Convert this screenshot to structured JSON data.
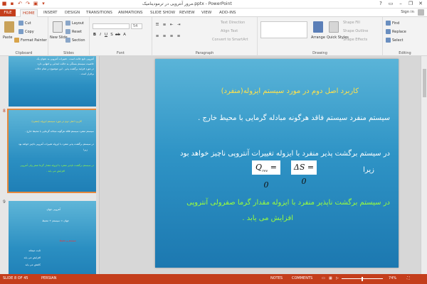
{
  "window": {
    "title": "مرور آنتروپی در ترمودینامیک.pptx - PowerPoint"
  },
  "qat": [
    "save-icon",
    "undo-icon",
    "redo-icon",
    "start-slideshow-icon",
    "customize-icon"
  ],
  "window_controls": [
    "?",
    "minimize",
    "restore",
    "close"
  ],
  "tabs": [
    "FILE",
    "HOME",
    "INSERT",
    "DESIGN",
    "TRANSITIONS",
    "ANIMATIONS",
    "SLIDE SHOW",
    "REVIEW",
    "VIEW",
    "ADD-INS"
  ],
  "active_tab": "HOME",
  "account": {
    "signin": "Sign in"
  },
  "ribbon": {
    "clipboard": {
      "paste": "Paste",
      "cut": "Cut",
      "copy": "Copy",
      "format_painter": "Format Painter",
      "label": "Clipboard"
    },
    "slides": {
      "new_slide": "New Slide",
      "layout": "Layout",
      "reset": "Reset",
      "section": "Section",
      "label": "Slides"
    },
    "font": {
      "name": "",
      "size": "54",
      "label": "Font"
    },
    "paragraph": {
      "text_direction": "Text Direction",
      "align_text": "Align Text",
      "convert": "Convert to SmartArt",
      "label": "Paragraph"
    },
    "drawing": {
      "arrange": "Arrange",
      "quick_styles": "Quick Styles",
      "shape_fill": "Shape Fill",
      "shape_outline": "Shape Outline",
      "shape_effects": "Shape Effects",
      "label": "Drawing"
    },
    "editing": {
      "find": "Find",
      "replace": "Replace",
      "select": "Select",
      "label": "Editing"
    }
  },
  "thumbnails": [
    {
      "number": "",
      "lines": [
        {
          "text": "آنتروپی تابع حالت است . تغییرات آنتروپی به عنوان یک",
          "c": ""
        },
        {
          "text": "خاصیت سیستم بستگی به حالت ابتدایی و انتهایی دارد",
          "c": ""
        },
        {
          "text": "در مورد فرایند برگشت پذیر . این موضوع در تمام حالات",
          "c": ""
        },
        {
          "text": "برقرار است .",
          "c": ""
        }
      ]
    },
    {
      "number": "8",
      "lines": [
        {
          "text": "کاربرد اصل دوم در مورد سیستم ایزوله (منفرد)",
          "c": "y"
        },
        {
          "text": "سیستم منفرد سیستم فاقد هرگونه مبادله گرمایی با محیط خارج .",
          "c": ""
        },
        {
          "text": "در سیستم برگشت پذیر منفرد با ایزوله تغییرات آنتروپی ناچیز خواهد بود",
          "c": ""
        },
        {
          "text": "زیرا",
          "c": ""
        },
        {
          "text": "در سیستم برگشت ناپذیر منفرد با ایزوله مقدار گرما صفر ولی آنتروپی",
          "c": "g"
        },
        {
          "text": "افزایش می یابد .",
          "c": "g"
        }
      ]
    },
    {
      "number": "9",
      "lines": [
        {
          "text": "آنتروپی جهان",
          "c": ""
        },
        {
          "text": "جهان = سیستم + محیط",
          "c": ""
        },
        {
          "text": "سیستم و محیط",
          "c": "r"
        },
        {
          "text": "ثابت میماند",
          "c": ""
        },
        {
          "text": "افزایش می یابد",
          "c": ""
        },
        {
          "text": "کاهش می یابد",
          "c": ""
        }
      ]
    }
  ],
  "slide": {
    "title": "کاربرد اصل دوم در مورد سیستم ایزوله(منفرد)",
    "p1": "سیستم منفرد سیستم فاقد هرگونه مبادله گرمایی با محیط خارج .",
    "p2a": "در سیستم برگشت پذیر منفرد با ایزوله تغییرات آنتروپی ناچیز خواهد بود",
    "p2b": "زیرا",
    "and": "و",
    "eq1": "ΔS = 0",
    "eq2_q": "Q",
    "eq2_sub": "rev",
    "eq2_rest": " = 0",
    "p3a": "در سیستم برگشت  ناپذیر منفرد با ایزوله مقدار گرما صفرولی آنتروپی",
    "p3b": "افزایش می یابد ."
  },
  "status": {
    "slide": "SLIDE 8 OF 45",
    "language": "PERSIAN",
    "notes": "NOTES",
    "comments": "COMMENTS",
    "zoom": "74%"
  },
  "colors": {
    "accent": "#c43e1c",
    "slide_yellow": "#ffe24a",
    "slide_green": "#9cff3a"
  }
}
